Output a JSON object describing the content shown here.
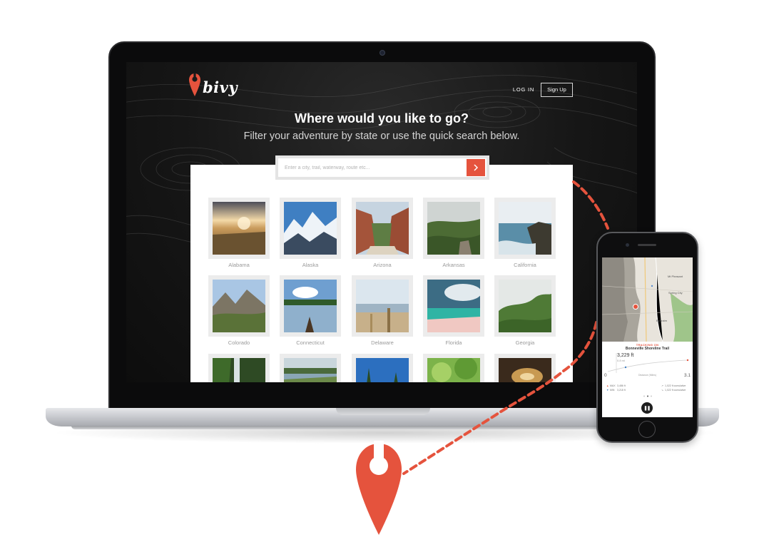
{
  "brand": {
    "name": "bivy",
    "accent_color": "#e5533d"
  },
  "nav": {
    "login_label": "LOG IN",
    "signup_label": "Sign Up"
  },
  "hero": {
    "title": "Where would you like to go?",
    "subtitle": "Filter your adventure by state or use the quick search below."
  },
  "search": {
    "placeholder": "Enter a city, trail, waterway, route etc...",
    "button_icon": "chevron-right-icon"
  },
  "states": [
    {
      "label": "Alabama"
    },
    {
      "label": "Alaska"
    },
    {
      "label": "Arizona"
    },
    {
      "label": "Arkansas"
    },
    {
      "label": "California"
    },
    {
      "label": "Colorado"
    },
    {
      "label": "Connecticut"
    },
    {
      "label": "Delaware"
    },
    {
      "label": "Florida"
    },
    {
      "label": "Georgia"
    }
  ],
  "phone_app": {
    "status": "TRACKING ON",
    "trail_name": "Bonneville Shoreline Trail",
    "elevation": "3,229 ft",
    "distance_done": "0.8 mi",
    "axis_start": "0",
    "axis_end": "3.1",
    "axis_label": "Distance (Miles)",
    "max_label": "MAX",
    "max_value": "3,486 ft",
    "min_label": "MIN",
    "min_value": "3,218 ft",
    "gain_cumulative": "1,022 ft cumulative",
    "loss_cumulative": "1,022 ft cumulative",
    "map_labels": {
      "mt_pleasant": "Mt Pleasant",
      "spring_city": "Spring City",
      "ephraim": "Ephraim"
    },
    "pause_icon": "pause-icon"
  }
}
